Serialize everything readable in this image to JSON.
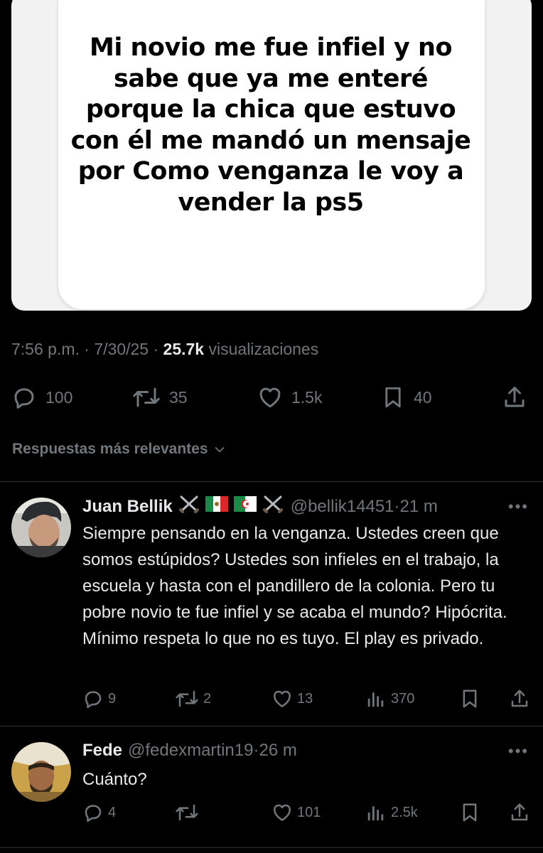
{
  "post": {
    "image_text": "Mi novio me fue infiel y no sabe que ya me enteré porque la chica que estuvo con él me mandó un mensaje por Como venganza le voy a vender la ps5",
    "time": "7:56 p.m.",
    "date": "7/30/25",
    "views_count": "25.7k",
    "views_label": "visualizaciones",
    "separator": "·",
    "replies": "100",
    "reposts": "35",
    "likes": "1.5k",
    "bookmarks": "40"
  },
  "replies_section": {
    "label": "Respuestas más relevantes"
  },
  "replies": [
    {
      "name": "Juan Bellik",
      "handle": "@bellik14451",
      "time": "21 m",
      "text": "Siempre pensando en la venganza. Ustedes creen que somos estúpidos? Ustedes son infieles en el trabajo, la escuela y hasta con el pandillero de la colonia. Pero tu pobre novio te fue infiel y se acaba el mundo? Hipócrita. Mínimo respeta lo que no es tuyo. El play es privado.",
      "replies": "9",
      "reposts": "2",
      "likes": "13",
      "views": "370"
    },
    {
      "name": "Fede",
      "handle": "@fedexmartin19",
      "time": "26 m",
      "text": "Cuánto?",
      "replies": "4",
      "reposts": "",
      "likes": "101",
      "views": "2.5k"
    }
  ],
  "colors": {
    "background": "#000000",
    "text": "#e7e9ea",
    "muted": "#71767b",
    "divider": "#2f3336"
  },
  "icons": [
    "reply-icon",
    "repost-icon",
    "like-icon",
    "bookmark-icon",
    "share-icon",
    "views-icon",
    "more-icon",
    "chevron-down-icon",
    "swords-icon",
    "mexico-flag-icon",
    "algeria-flag-icon"
  ]
}
